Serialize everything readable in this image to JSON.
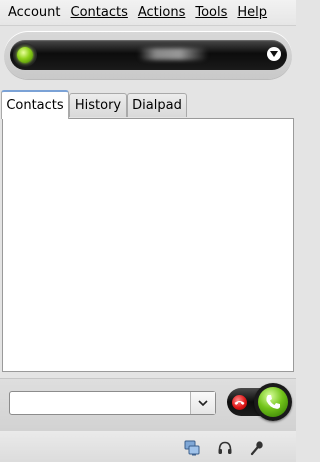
{
  "menu": {
    "items": [
      {
        "label": "Account",
        "accel_index": -1
      },
      {
        "label": "Contacts",
        "accel_index": 0
      },
      {
        "label": "Actions",
        "accel_index": 0
      },
      {
        "label": "Tools",
        "accel_index": 0
      },
      {
        "label": "Help",
        "accel_index": 0
      }
    ]
  },
  "status": {
    "state_color": "#8fd11a",
    "icons": {
      "indicator": "status-online-icon",
      "dropdown": "chevron-down-icon"
    }
  },
  "tabs": [
    {
      "label": "Contacts",
      "active": true
    },
    {
      "label": "History",
      "active": false
    },
    {
      "label": "Dialpad",
      "active": false
    }
  ],
  "dial": {
    "value": "",
    "placeholder": ""
  },
  "call": {
    "hangup_color": "#e01818",
    "call_color": "#72c31a",
    "icons": {
      "hangup": "hangup-icon",
      "call": "phone-icon"
    }
  },
  "footer": {
    "icons": [
      "screen-share-icon",
      "headset-icon",
      "microphone-icon"
    ]
  }
}
